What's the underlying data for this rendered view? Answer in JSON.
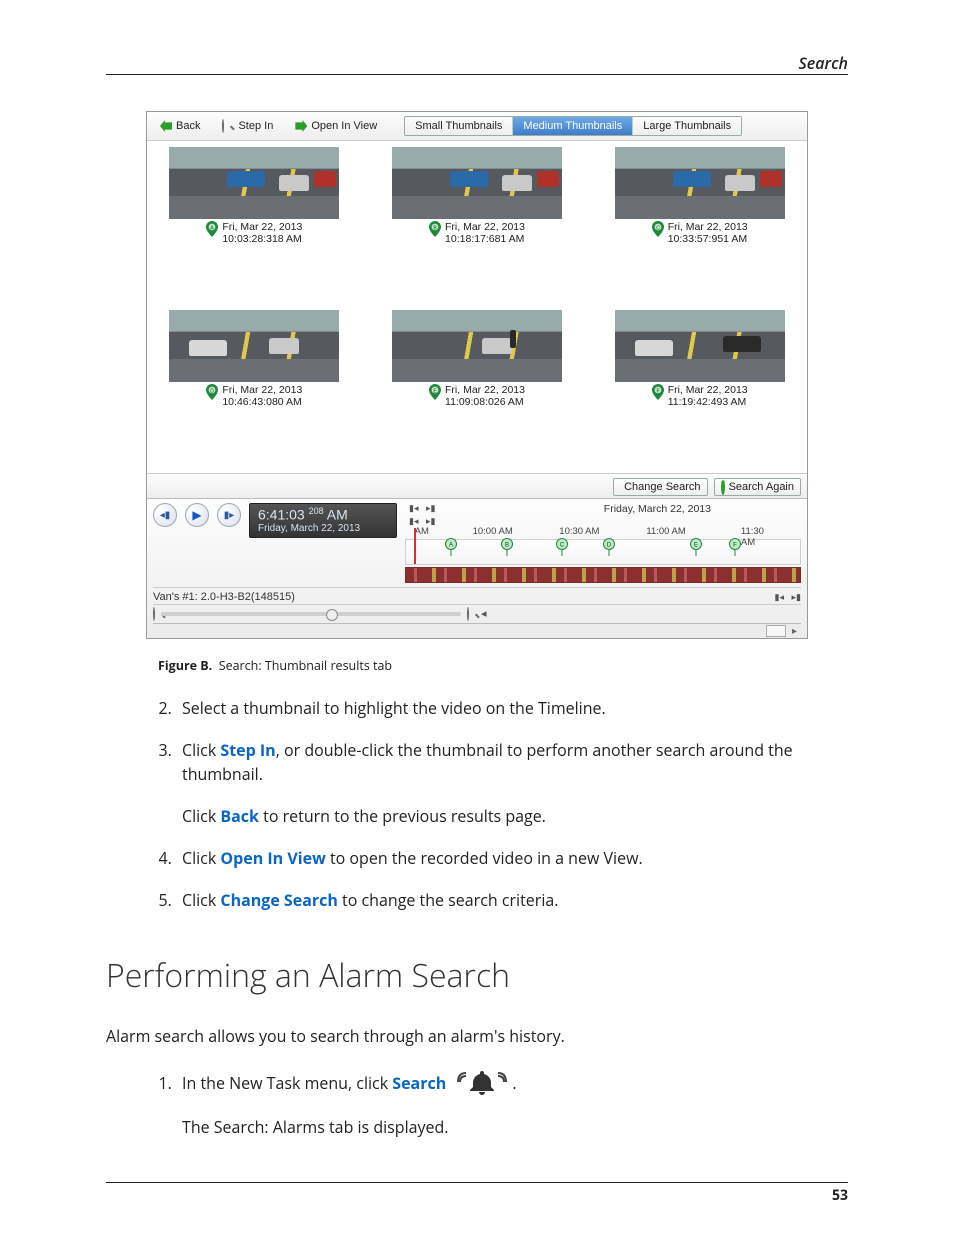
{
  "header": {
    "section": "Search"
  },
  "screenshot": {
    "toolbar": {
      "back": "Back",
      "step_in": "Step In",
      "open_in_view": "Open In View",
      "size_tabs": {
        "small": "Small Thumbnails",
        "medium": "Medium Thumbnails",
        "large": "Large Thumbnails"
      }
    },
    "thumbs": [
      {
        "marker": "A",
        "date": "Fri, Mar 22, 2013",
        "time": "10:03:28:318 AM"
      },
      {
        "marker": "B",
        "date": "Fri, Mar 22, 2013",
        "time": "10:18:17:681 AM"
      },
      {
        "marker": "C",
        "date": "Fri, Mar 22, 2013",
        "time": "10:33:57:951 AM"
      },
      {
        "marker": "D",
        "date": "Fri, Mar 22, 2013",
        "time": "10:46:43:080 AM"
      },
      {
        "marker": "E",
        "date": "Fri, Mar 22, 2013",
        "time": "11:09:08:026 AM"
      },
      {
        "marker": "F",
        "date": "Fri, Mar 22, 2013",
        "time": "11:19:42:493 AM"
      }
    ],
    "footer": {
      "change_search": "Change Search",
      "search_again": "Search Again"
    },
    "playback": {
      "time": "6:41:03",
      "ms": "208",
      "ampm": "AM",
      "date": "Friday, March 22, 2013"
    },
    "timeline": {
      "date_label": "Friday, March 22, 2013",
      "ticks": [
        "AM",
        "10:00 AM",
        "10:30 AM",
        "11:00 AM",
        "11:30 AM"
      ]
    },
    "camera_label": "Van's #1: 2.0-H3-B2(148515)"
  },
  "figure": {
    "label": "Figure B.",
    "caption": "Search: Thumbnail results tab"
  },
  "steps": {
    "s2": "Select a thumbnail to highlight the video on the Timeline.",
    "s3a": "Click ",
    "s3_term": "Step In",
    "s3b": ", or double-click the thumbnail to perform another search around the thumbnail.",
    "s3_sub_a": "Click ",
    "s3_sub_term": "Back",
    "s3_sub_b": " to return to the previous results page.",
    "s4a": "Click ",
    "s4_term": "Open In View",
    "s4b": " to open the recorded video in a new View.",
    "s5a": "Click ",
    "s5_term": "Change Search",
    "s5b": " to change the search criteria."
  },
  "section2": {
    "heading": "Performing an Alarm Search",
    "intro": "Alarm search allows you to search through an alarm's history.",
    "step1a": "In the New Task menu, click ",
    "step1_term": "Search",
    "step1b": ".",
    "step1_sub": "The Search: Alarms tab is displayed."
  },
  "page_number": "53"
}
